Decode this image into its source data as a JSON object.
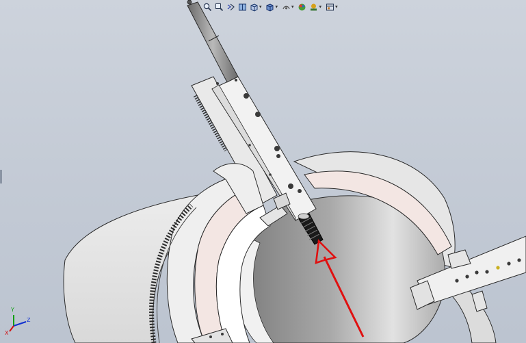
{
  "toolbar": {
    "items": [
      {
        "icon": "zoom-to-fit-icon",
        "dropdown": false
      },
      {
        "icon": "zoom-to-area-icon",
        "dropdown": false
      },
      {
        "icon": "previous-view-icon",
        "dropdown": false
      },
      {
        "icon": "section-view-icon",
        "dropdown": false
      },
      {
        "icon": "view-orientation-icon",
        "dropdown": true
      },
      {
        "icon": "display-style-icon",
        "dropdown": true
      },
      {
        "icon": "hide-show-items-icon",
        "dropdown": true
      },
      {
        "icon": "edit-appearance-icon",
        "dropdown": false
      },
      {
        "icon": "apply-scene-icon",
        "dropdown": true
      },
      {
        "icon": "view-settings-icon",
        "dropdown": true
      }
    ]
  },
  "triad": {
    "x_label": "X",
    "y_label": "Y",
    "z_label": "Z"
  },
  "colors": {
    "background": "#c3cad5",
    "part_face": "#e8e6e6",
    "part_edge": "#2a2a2a",
    "inner_bore_dark": "#6e6e6e",
    "annotation_arrow": "#e01010",
    "triad_x": "#d01010",
    "triad_y": "#10a010",
    "triad_z": "#1030d0"
  }
}
